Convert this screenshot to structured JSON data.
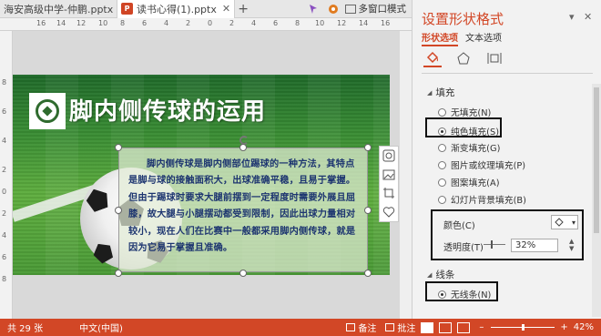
{
  "tabs": [
    {
      "label": "海安高级中学-仲鹏.pptx",
      "active": false
    },
    {
      "label": "读书心得(1).pptx",
      "active": true,
      "close": "✕"
    }
  ],
  "toolbar": {
    "new_tab": "+",
    "multi_window_label": "多窗口模式"
  },
  "ruler": {
    "top": [
      "16",
      "14",
      "12",
      "10",
      "8",
      "6",
      "4",
      "2",
      "0",
      "2",
      "4",
      "6",
      "8",
      "10",
      "12",
      "14",
      "16"
    ],
    "left": [
      "8",
      "6",
      "4",
      "2",
      "0",
      "2",
      "4",
      "6",
      "8"
    ]
  },
  "slide": {
    "title": "脚内侧传球的运用",
    "body": "脚内侧传球是脚内侧部位踢球的一种方法，其特点是脚与球的接触面积大，出球准确平稳，且易于掌握。但由于踢球时要求大腿前摆到一定程度时需要外展且屈膝，故大腿与小腿摆动都受到限制，因此出球力量相对较小，现在人们在比赛中一般都采用脚内侧传球，就是因为它易于掌握且准确。"
  },
  "statusbar": {
    "slide_count": "共 29 张",
    "language": "中文(中国)",
    "notes_label": "备注",
    "comments_label": "批注",
    "zoom_minus": "–",
    "zoom_plus": "+",
    "zoom": "42%"
  },
  "panel": {
    "title": "设置形状格式",
    "dropdown": "▾",
    "close": "✕",
    "tabs": [
      {
        "label": "形状选项",
        "active": true
      },
      {
        "label": "文本选项",
        "active": false
      }
    ],
    "fill": {
      "header": "填充",
      "options": [
        {
          "label": "无填充(N)",
          "selected": false
        },
        {
          "label": "纯色填充(S)",
          "selected": true
        },
        {
          "label": "渐变填充(G)",
          "selected": false
        },
        {
          "label": "图片或纹理填充(P)",
          "selected": false
        },
        {
          "label": "图案填充(A)",
          "selected": false
        },
        {
          "label": "幻灯片背景填充(B)",
          "selected": false
        }
      ],
      "color_label": "颜色(C)",
      "transparency_label": "透明度(T)",
      "transparency_value": "32%"
    },
    "line": {
      "header": "线条",
      "options": [
        {
          "label": "无线条(N)",
          "selected": true
        }
      ]
    }
  },
  "colors": {
    "accent": "#d24726",
    "text_body": "#1d3570",
    "panel_bg": "#f2f2f2"
  },
  "icons": [
    "powerpoint-file-icon",
    "pin-icon",
    "gear-icon",
    "multi-window-icon",
    "fill-bucket-icon",
    "pentagon-effects-icon",
    "size-properties-icon",
    "soccer-ball-icon",
    "layout-options-icon",
    "picture-icon",
    "crop-icon",
    "heart-shape-icon",
    "notes-icon",
    "comments-icon",
    "normal-view-icon",
    "slide-sorter-icon",
    "reading-view-icon"
  ]
}
